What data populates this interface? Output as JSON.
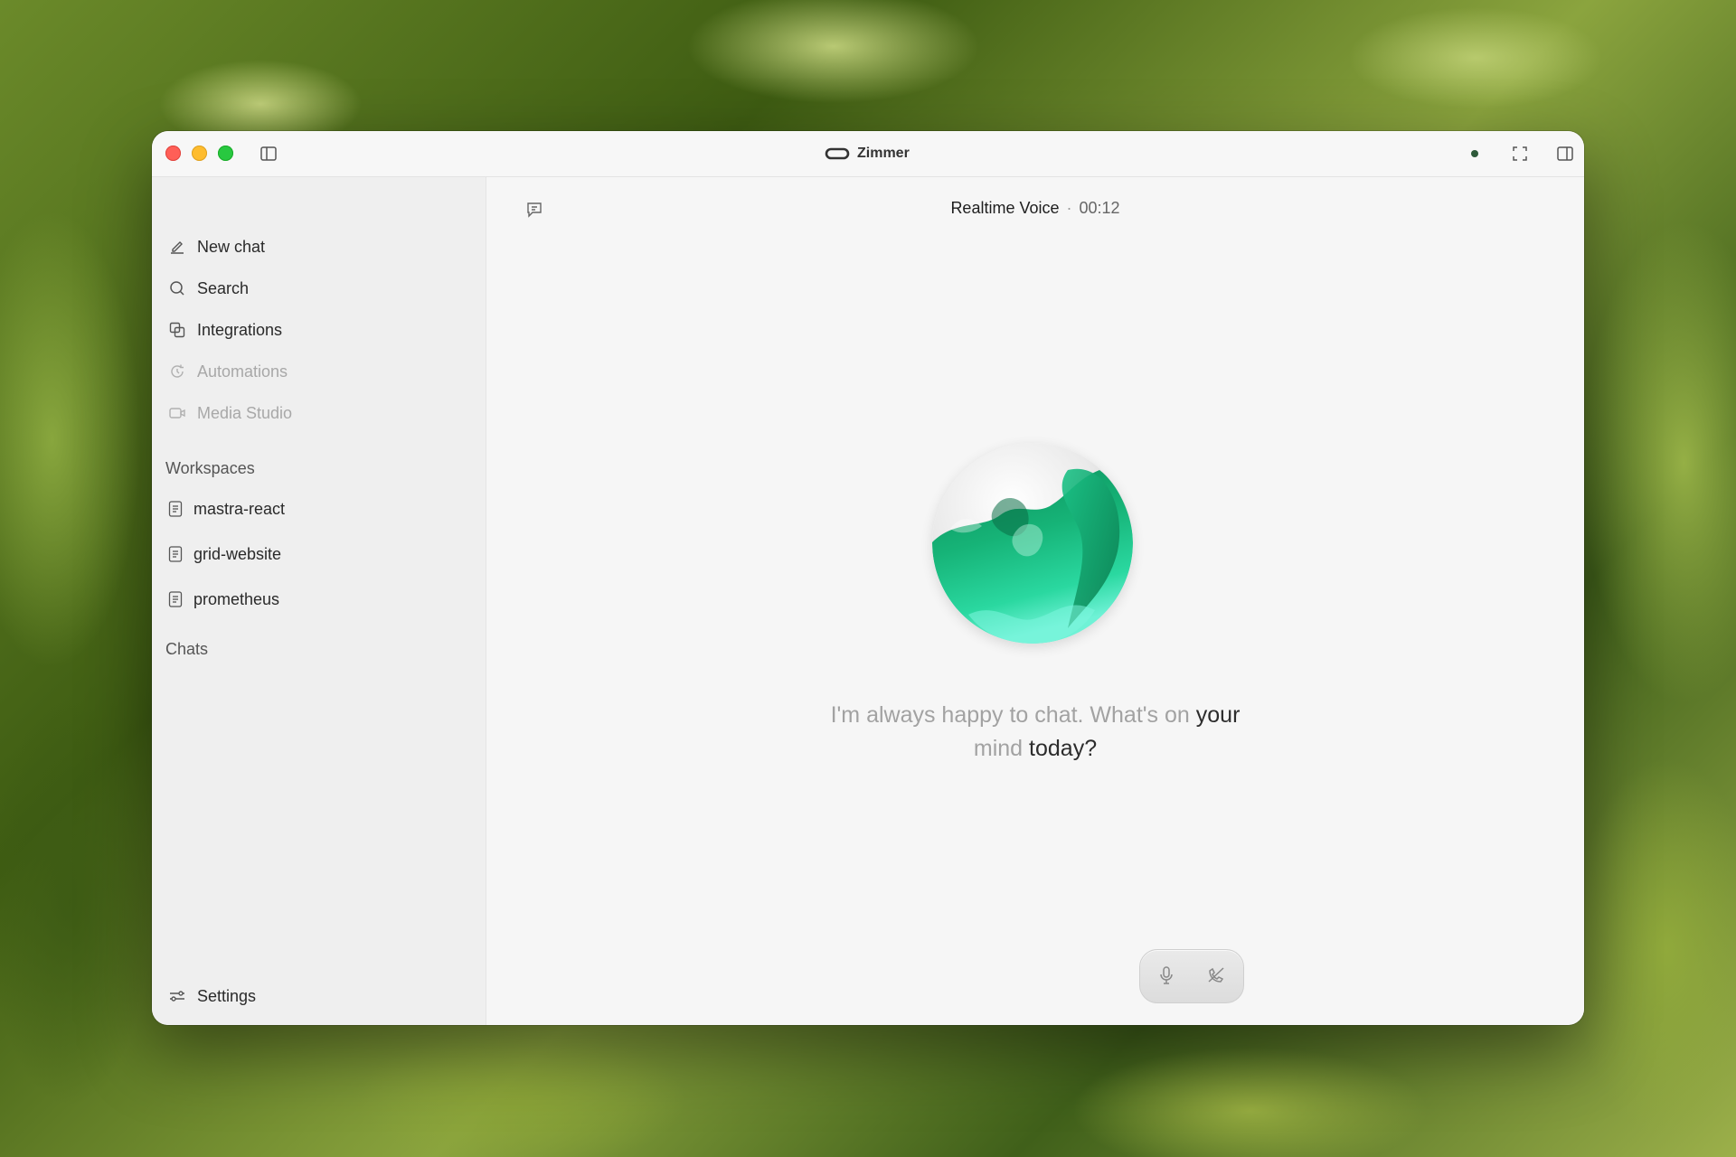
{
  "app": {
    "title": "Zimmer"
  },
  "sidebar": {
    "nav": [
      {
        "label": "New chat",
        "icon": "pencil-icon",
        "enabled": true
      },
      {
        "label": "Search",
        "icon": "search-icon",
        "enabled": true
      },
      {
        "label": "Integrations",
        "icon": "integrations-icon",
        "enabled": true
      },
      {
        "label": "Automations",
        "icon": "automations-icon",
        "enabled": false
      },
      {
        "label": "Media Studio",
        "icon": "video-camera-icon",
        "enabled": false
      }
    ],
    "workspaces_label": "Workspaces",
    "workspaces": [
      {
        "label": "mastra-react",
        "icon": "document-icon"
      },
      {
        "label": "grid-website",
        "icon": "document-icon"
      },
      {
        "label": "prometheus",
        "icon": "document-icon"
      }
    ],
    "chats_label": "Chats",
    "settings_label": "Settings"
  },
  "main": {
    "title": "Realtime Voice",
    "separator": "·",
    "timer": "00:12",
    "message": {
      "dim_part_1": "I'm always happy to chat. What's on ",
      "strong_part_1": "your",
      "dim_part_2": "mind ",
      "strong_part_2": "today?"
    }
  },
  "colors": {
    "accent_green": "#10b981",
    "traffic_red": "#ff5f57",
    "traffic_yellow": "#febc2e",
    "traffic_green": "#28c840"
  }
}
